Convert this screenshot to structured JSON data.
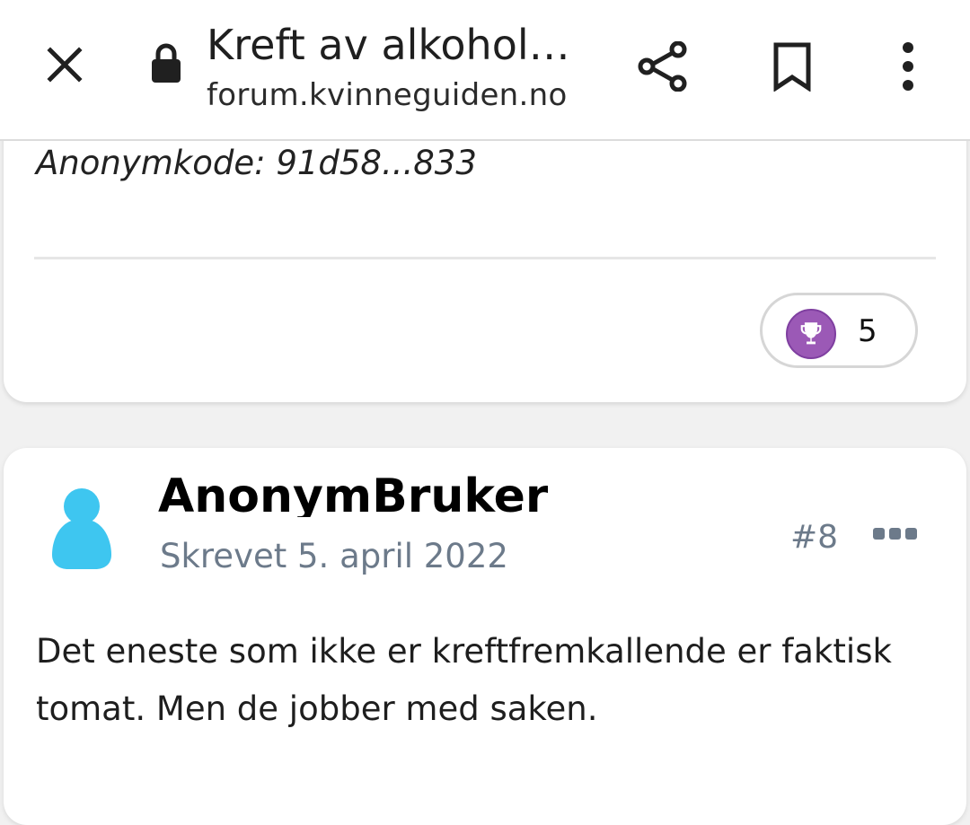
{
  "browser": {
    "page_title": "Kreft av alkohol?...",
    "domain": "forum.kvinneguiden.no",
    "icons": {
      "close": "close-icon",
      "lock": "lock-icon",
      "share": "share-icon",
      "bookmark": "bookmark-icon",
      "more": "more-vert-icon"
    }
  },
  "previous_post": {
    "anon_code": "Anonymkode: 91d58...833",
    "reaction": {
      "icon": "trophy-icon",
      "count": "5",
      "color": "#9b59b6"
    }
  },
  "post": {
    "author": "AnonymBruker",
    "posted": "Skrevet 5. april 2022",
    "number": "#8",
    "avatar_icon": "person-silhouette-icon",
    "avatar_color": "#3ec6f0",
    "body": "Det eneste som ikke er kreftfremkallende er faktisk tomat. Men de jobber med saken."
  }
}
